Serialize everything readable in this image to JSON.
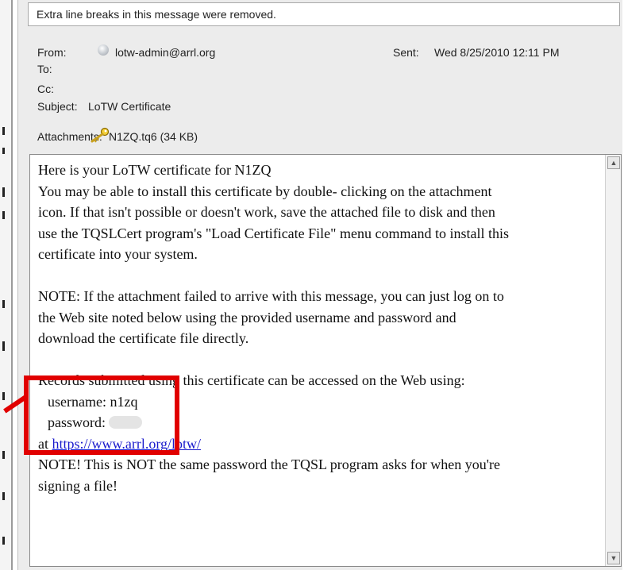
{
  "info_bar": {
    "text": "Extra line breaks in this message were removed."
  },
  "header": {
    "from_label": "From:",
    "from_value": "lotw-admin@arrl.org",
    "to_label": "To:",
    "cc_label": "Cc:",
    "subject_label": "Subject:",
    "subject_value": "LoTW Certificate",
    "sent_label": "Sent:",
    "sent_value": "Wed 8/25/2010 12:11 PM",
    "attachments_label": "Attachments:",
    "attachment_name": "N1ZQ.tq6 (34 KB)"
  },
  "body": {
    "line1": "Here is your LoTW certificate for N1ZQ",
    "line2": "You may be able to install this certificate by double- clicking on the attachment",
    "line3": "icon. If that isn't possible or doesn't work, save the attached file to disk and then",
    "line4": "use the TQSLCert program's \"Load Certificate File\" menu command to install this",
    "line5": "certificate into your system.",
    "note1_line1": "NOTE: If the attachment failed to arrive with this message, you can just log on to",
    "note1_line2": "the Web site noted below using the provided username and password and",
    "note1_line3": "download the certificate file directly.",
    "records_line": "Records submitted using this certificate can be accessed on the Web using:",
    "username_line": "username: n1zq",
    "password_label": "password:",
    "at_label": "at",
    "url": "https://www.arrl.org/lotw/",
    "note2_line1": "NOTE! This is NOT the same password the TQSL program asks for when you're",
    "note2_line2": "signing a file!"
  },
  "colors": {
    "highlight": "#e10000",
    "link": "#1a1acc"
  },
  "icons": {
    "sender": "contact-status-icon",
    "attachment": "key-icon",
    "scroll_up": "scroll-up-arrow-icon",
    "scroll_down": "scroll-down-arrow-icon"
  }
}
